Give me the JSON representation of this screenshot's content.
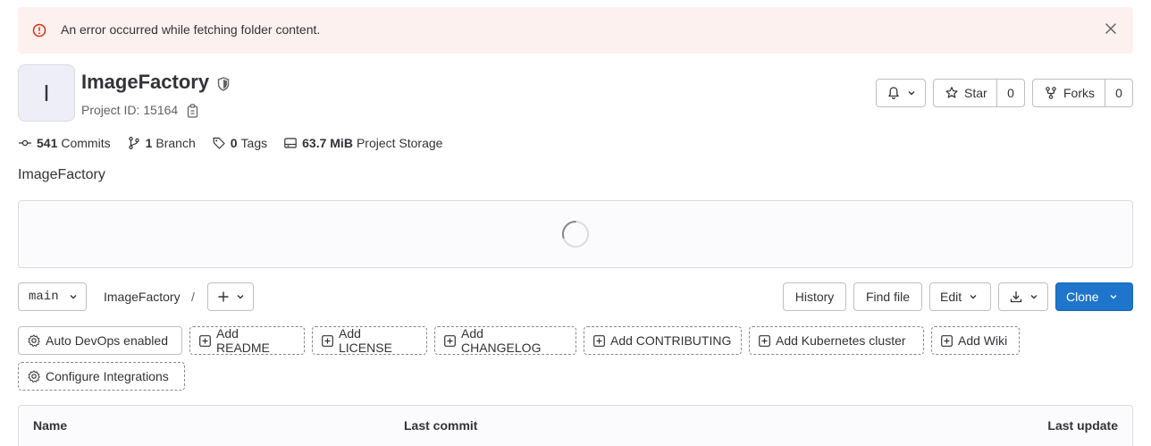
{
  "alert": {
    "message": "An error occurred while fetching folder content.",
    "icon": "error-circle-icon",
    "color": "#dd2b0e"
  },
  "project": {
    "avatar_letter": "I",
    "title": "ImageFactory",
    "id_label": "Project ID: 15164",
    "description": "ImageFactory"
  },
  "actions": {
    "star_label": "Star",
    "star_count": "0",
    "forks_label": "Forks",
    "forks_count": "0"
  },
  "stats": {
    "commits_count": "541",
    "commits_label": "Commits",
    "branch_count": "1",
    "branch_label": "Branch",
    "tags_count": "0",
    "tags_label": "Tags",
    "storage_size": "63.7 MiB",
    "storage_label": "Project Storage"
  },
  "repo_toolbar": {
    "branch": "main",
    "breadcrumb_root": "ImageFactory",
    "breadcrumb_sep": "/",
    "history": "History",
    "find_file": "Find file",
    "edit": "Edit",
    "clone": "Clone"
  },
  "shortcuts": [
    "Auto DevOps enabled",
    "Add README",
    "Add LICENSE",
    "Add CHANGELOG",
    "Add CONTRIBUTING",
    "Add Kubernetes cluster",
    "Add Wiki",
    "Configure Integrations"
  ],
  "table": {
    "col_name": "Name",
    "col_commit": "Last commit",
    "col_update": "Last update"
  },
  "colors": {
    "primary": "#1f75cb",
    "alert_bg": "#fcf1ef"
  }
}
